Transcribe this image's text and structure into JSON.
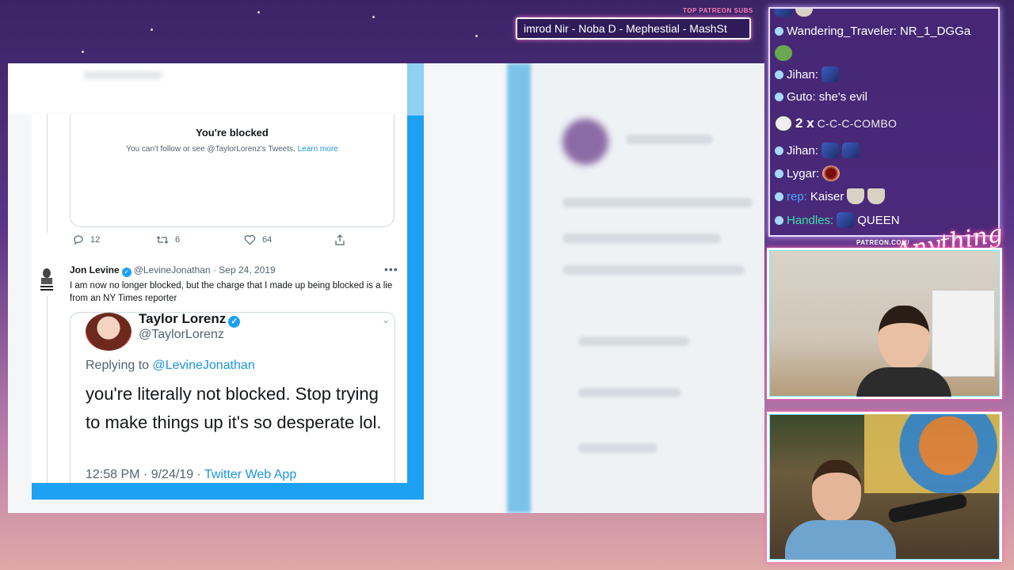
{
  "banner": {
    "heading": "TOP PATREON SUBS",
    "subs": "imrod Nir - Noba D - Mephestial - MashSt"
  },
  "blocked": {
    "title": "You're blocked",
    "text": "You can't follow or see @TaylorLorenz's Tweets.",
    "link": "Learn more"
  },
  "actions": {
    "reply_count": "12",
    "retweet_count": "6",
    "like_count": "64"
  },
  "jon_tweet": {
    "name": "Jon Levine",
    "handle": "@LevineJonathan",
    "date": "· Sep 24, 2019",
    "more": "•••",
    "text": "I am now no longer blocked, but the charge that I made up being blocked is a lie from an NY Times reporter"
  },
  "taylor_tweet": {
    "name": "Taylor Lorenz",
    "handle": "@TaylorLorenz",
    "replying_prefix": "Replying to",
    "replying_to": "@LevineJonathan",
    "text": "you're literally not blocked. Stop trying to make things up it's so desperate lol.",
    "time": "12:58 PM · 9/24/19 ·",
    "source": "Twitter Web App"
  },
  "chat": {
    "messages": [
      {
        "user": "Wandering_Traveler:",
        "text": "NR_1_DGGa"
      },
      {
        "user": "Jihan:",
        "text": ""
      },
      {
        "user": "Guto:",
        "text": "she's evil"
      },
      {
        "combo_count": "2 x",
        "combo_text": "C-C-C-COMBO"
      },
      {
        "user": "Jihan:",
        "text": ""
      },
      {
        "user": "Lygar:",
        "text": ""
      },
      {
        "user": "rep:",
        "text": "Kaiser"
      },
      {
        "user": "Handles:",
        "text": "QUEEN"
      }
    ]
  },
  "brand": {
    "url": "PATREON.COM/",
    "script": "Anything Else"
  },
  "colors": {
    "twitter_blue": "#1da1f2",
    "link_blue": "#1b95e0",
    "chat_bg": "#48287a",
    "rep_color": "#4aa8ff",
    "handles_color": "#3fe0a8"
  }
}
